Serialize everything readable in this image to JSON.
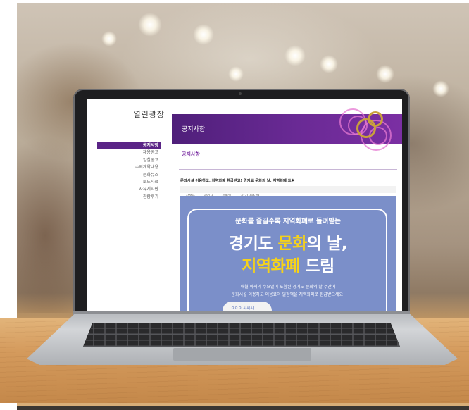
{
  "site": {
    "title": "열린광장"
  },
  "nav": {
    "items": [
      "공지사항",
      "채용공고",
      "입찰공고",
      "수의계약내용",
      "문화뉴스",
      "보도자료",
      "자유게시판",
      "관람후기"
    ],
    "active_index": 0
  },
  "banner": {
    "title": "공지사항"
  },
  "section": {
    "heading": "공지사항"
  },
  "post": {
    "title": "문화시설 이용하고, 지역화폐 환급받고! 경기도 문화의 날, 지역화폐 드림",
    "meta_author_label": "작성자",
    "meta_author": "관리자",
    "meta_date_label": "등록일",
    "meta_date": "2021-04-29"
  },
  "poster": {
    "subtitle": "문화를 즐길수록 지역화폐로 돌려받는",
    "line1_a": "경기도 ",
    "line1_b": "문화",
    "line1_c": "의 날,",
    "line2_a": "지역화폐",
    "line2_b": " 드림",
    "desc1": "매월 마지막 수요일이 포함된 경기도 문화의 날 주간에",
    "desc2": "문화시설 이용하고 이용료의 일정액을 지역화폐로 환급받으세요!",
    "cloud_text": "ㅇㅇㅇ 시시시"
  },
  "colors": {
    "accent": "#5a2486",
    "banner": "#6a2a95",
    "poster_bg": "#7b8fc9",
    "highlight": "#f5d21a"
  }
}
